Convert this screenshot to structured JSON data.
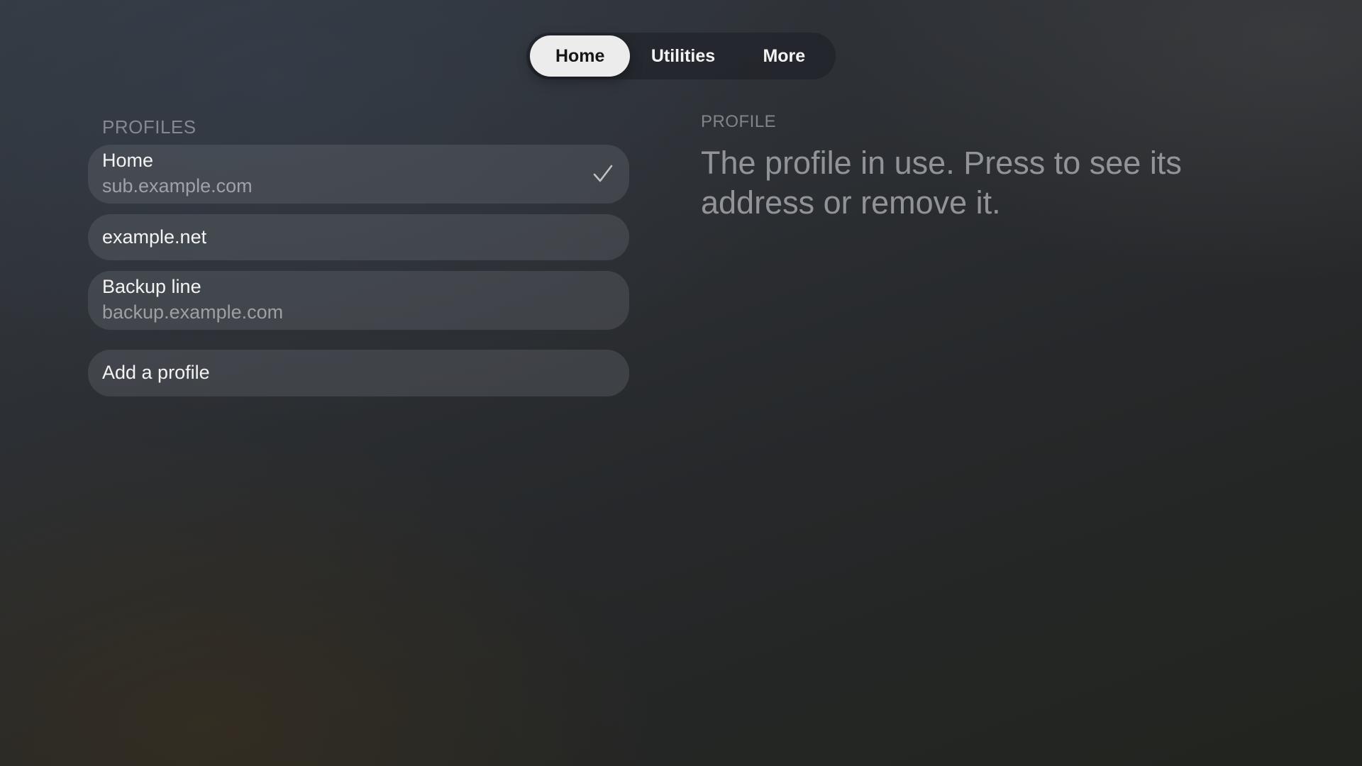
{
  "tabs": [
    {
      "label": "Home",
      "active": true
    },
    {
      "label": "Utilities",
      "active": false
    },
    {
      "label": "More",
      "active": false
    }
  ],
  "profiles": {
    "heading": "PROFILES",
    "items": [
      {
        "title": "Home",
        "subtitle": "sub.example.com",
        "selected": true
      },
      {
        "title": "example.net",
        "subtitle": "",
        "selected": false
      },
      {
        "title": "Backup line",
        "subtitle": "backup.example.com",
        "selected": false
      }
    ],
    "add_label": "Add a profile"
  },
  "detail": {
    "heading": "PROFILE",
    "body": "The profile in use. Press to see its address or remove it."
  },
  "icons": {
    "selected_marker": "checkmark-icon"
  }
}
